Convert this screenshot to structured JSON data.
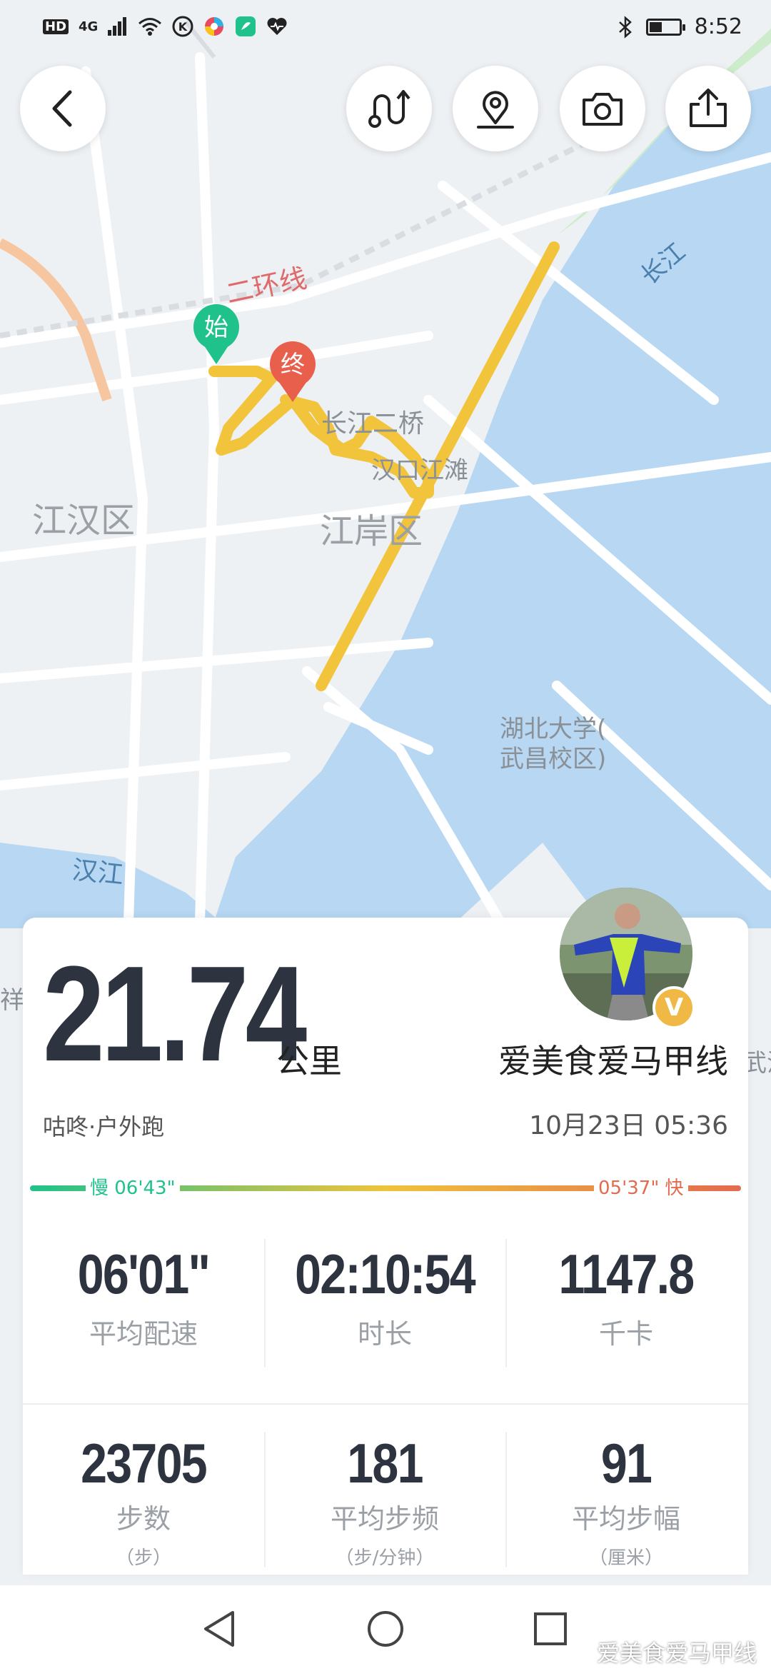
{
  "status_bar": {
    "network_label": "HD",
    "signal_label": "4G",
    "time": "8:52",
    "battery_level": 0.45
  },
  "toolbar": {
    "back": "back-icon",
    "route": "route-icon",
    "location": "location-pin-icon",
    "camera": "camera-icon",
    "share": "share-icon"
  },
  "map": {
    "start_marker": "始",
    "end_marker": "终",
    "labels": {
      "ring_road": "二环线",
      "yangtze": "长江",
      "bridge": "长江二桥",
      "hankou": "汉口江滩",
      "jianghan": "江汉区",
      "jiangan": "江岸区",
      "hubei_univ_1": "湖北大学(",
      "hubei_univ_2": "武昌校区)",
      "hanjiang": "汉江",
      "left_edge": "祥",
      "right_edge": "武汉"
    },
    "colors": {
      "water": "#b7d7f2",
      "route": "#f2c43c",
      "land": "#eef1f4"
    }
  },
  "summary": {
    "distance": "21.74",
    "unit": "公里",
    "username": "爱美食爱马甲线",
    "verified_badge": "V",
    "source": "咕咚·户外跑",
    "datetime": "10月23日 05:36",
    "pace_slow": "慢 06'43\"",
    "pace_fast": "05'37\" 快",
    "pace_colors": {
      "slow": "#1fc28a",
      "mid": "#f0c33c",
      "fast": "#e36b4e"
    }
  },
  "stats": [
    {
      "value": "06'01\"",
      "label": "平均配速",
      "sub": ""
    },
    {
      "value": "02:10:54",
      "label": "时长",
      "sub": ""
    },
    {
      "value": "1147.8",
      "label": "千卡",
      "sub": ""
    },
    {
      "value": "23705",
      "label": "步数",
      "sub": "（步）"
    },
    {
      "value": "181",
      "label": "平均步频",
      "sub": "（步/分钟）"
    },
    {
      "value": "91",
      "label": "平均步幅",
      "sub": "（厘米）"
    }
  ],
  "watermark": "爱美食爱马甲线"
}
